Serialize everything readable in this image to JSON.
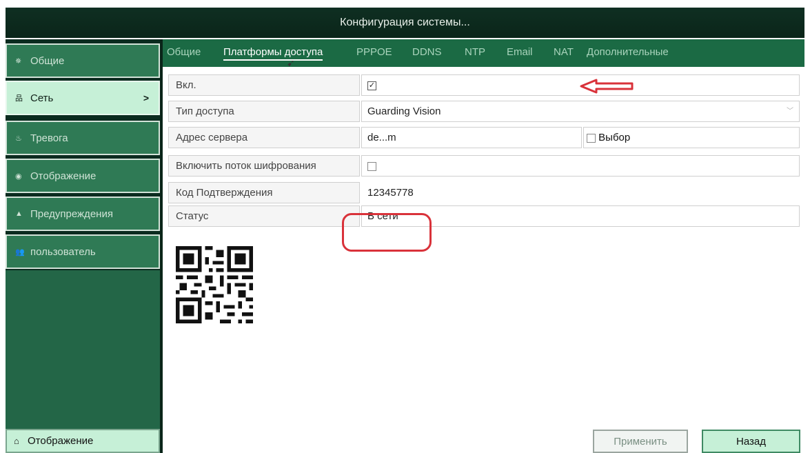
{
  "window": {
    "title": "Конфигурация системы..."
  },
  "sidebar": {
    "items": [
      {
        "label": "Общие",
        "icon": "gear-icon",
        "active": false
      },
      {
        "label": "Сеть",
        "icon": "network-icon",
        "active": true,
        "chevron": ">"
      },
      {
        "label": "Тревога",
        "icon": "alarm-icon",
        "active": false
      },
      {
        "label": "Отображение",
        "icon": "eye-icon",
        "active": false
      },
      {
        "label": "Предупреждения",
        "icon": "warning-icon",
        "active": false
      },
      {
        "label": "пользователь",
        "icon": "users-icon",
        "active": false
      }
    ],
    "bottom": {
      "label": "Отображение",
      "icon": "home-icon"
    }
  },
  "tabs": [
    {
      "label": "Общие"
    },
    {
      "label": "Платформы доступа",
      "active": true
    },
    {
      "label": "PPPOE"
    },
    {
      "label": "DDNS"
    },
    {
      "label": "NTP"
    },
    {
      "label": "Email"
    },
    {
      "label": "NAT"
    },
    {
      "label": "Дополнительные"
    }
  ],
  "form": {
    "enable": {
      "label": "Вкл.",
      "checked": true,
      "mark": "✓"
    },
    "access_type": {
      "label": "Тип доступа",
      "value": "Guarding Vision"
    },
    "server_address": {
      "label": "Адрес сервера",
      "value": "de...m",
      "select_label": "Выбор",
      "select_checked": false
    },
    "encryption": {
      "label": "Включить поток шифрования",
      "checked": false
    },
    "verification_code": {
      "label": "Код Подтверждения",
      "value": "12345778"
    },
    "status": {
      "label": "Статус",
      "value": "В сети"
    }
  },
  "buttons": {
    "apply": "Применить",
    "back": "Назад"
  },
  "colors": {
    "titlebar": "#0f2f22",
    "sidebar_item": "#2f7a55",
    "sidebar_active": "#c6f0d7",
    "tabbar": "#1b6a44",
    "annotation_red": "#d9323a"
  }
}
